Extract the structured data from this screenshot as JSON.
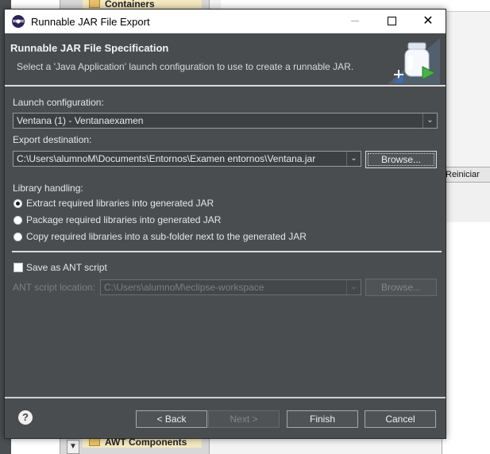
{
  "background": {
    "palette_header_top": "Containers",
    "palette_header_bottom": "AWT Components",
    "reiniciar_label": "Reiniciar"
  },
  "dialog": {
    "title": "Runnable JAR File Export",
    "heading": "Runnable JAR File Specification",
    "description": "Select a 'Java Application' launch configuration to use to create a runnable JAR.",
    "launch_config": {
      "label": "Launch configuration:",
      "value": "Ventana (1) - Ventanaexamen"
    },
    "export_destination": {
      "label": "Export destination:",
      "value": "C:\\Users\\alumnoM\\Documents\\Entornos\\Examen entornos\\Ventana.jar",
      "browse_label": "Browse..."
    },
    "library_handling": {
      "label": "Library handling:",
      "options": [
        {
          "label": "Extract required libraries into generated JAR",
          "checked": true
        },
        {
          "label": "Package required libraries into generated JAR",
          "checked": false
        },
        {
          "label": "Copy required libraries into a sub-folder next to the generated JAR",
          "checked": false
        }
      ]
    },
    "ant": {
      "checkbox_label": "Save as ANT script",
      "checked": false,
      "location_label": "ANT script location:",
      "location_value": "C:\\Users\\alumnoM\\eclipse-workspace",
      "browse_label": "Browse..."
    },
    "buttons": {
      "back": "< Back",
      "next": "Next >",
      "finish": "Finish",
      "cancel": "Cancel"
    }
  }
}
